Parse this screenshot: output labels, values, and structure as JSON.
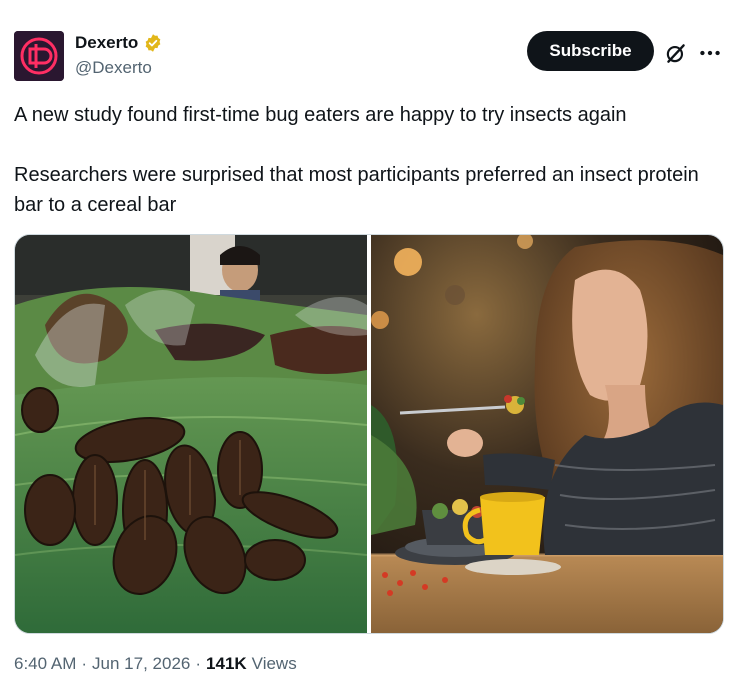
{
  "author": {
    "display_name": "Dexerto",
    "handle": "@Dexerto",
    "avatar_icon": "dexerto-logo-icon",
    "verified_icon": "gold-verified-badge-icon",
    "verified_color": "#e2b719"
  },
  "actions": {
    "subscribe_label": "Subscribe",
    "grok_icon": "grok-icon",
    "more_icon": "more-icon"
  },
  "tweet": {
    "text": "A new study found first-time bug eaters are happy to try insects again\n\nResearchers were surprised that most participants preferred an insect protein bar to a cereal bar"
  },
  "media": {
    "left_image": "fried-insects-on-banana-leaves-photo",
    "right_image": "woman-eating-in-cafe-photo"
  },
  "meta": {
    "time": "6:40 AM",
    "date": "Jun 17, 2026",
    "views_count": "141K",
    "views_label": "Views"
  }
}
